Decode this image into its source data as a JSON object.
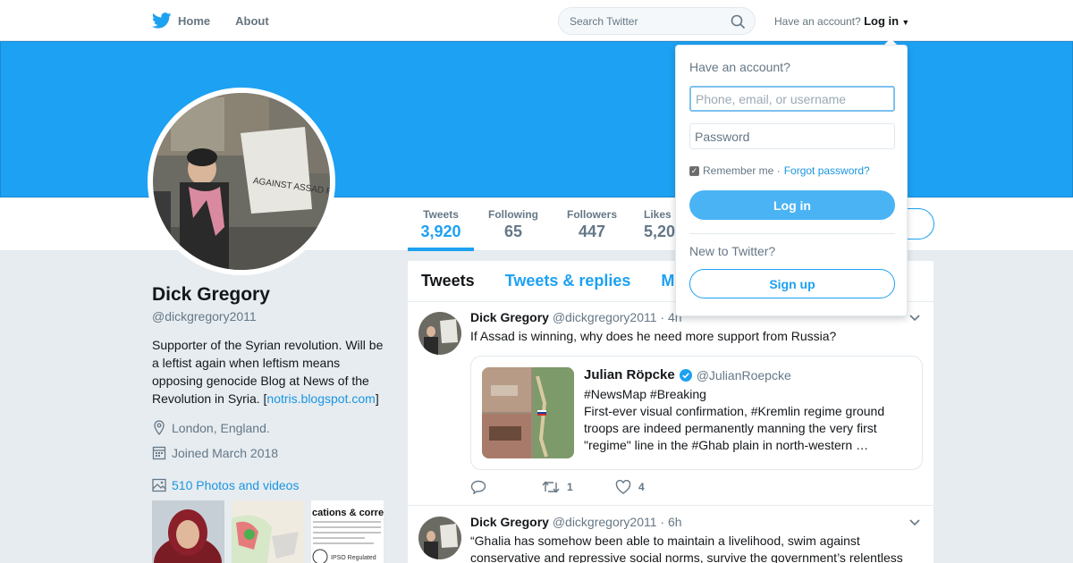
{
  "nav": {
    "home_label": "Home",
    "about_label": "About",
    "search_placeholder": "Search Twitter",
    "have_account_text": "Have an account?",
    "login_label": "Log in"
  },
  "colors": {
    "accent": "#1da1f2",
    "banner": "#1da1f2",
    "link": "#1b95e0"
  },
  "stats": [
    {
      "label": "Tweets",
      "value": "3,920"
    },
    {
      "label": "Following",
      "value": "65"
    },
    {
      "label": "Followers",
      "value": "447"
    },
    {
      "label": "Likes",
      "value": "5,20"
    }
  ],
  "profile": {
    "name": "Dick Gregory",
    "handle": "@dickgregory2011",
    "bio_text": "Supporter of the Syrian revolution. Will be a leftist again when leftism means opposing genocide Blog at News of the Revolution in Syria. [",
    "bio_link": "notris.blogspot.com",
    "bio_end": "]",
    "location": "London, England.",
    "joined": "Joined March 2018",
    "photos_label": "510 Photos and videos",
    "avatar_sign_text": "AGAINST ASSAD RUSSIA IRAN",
    "thumb3_title": "cations & correc",
    "thumb3_badge": "IPSO Regulated"
  },
  "timeline": {
    "tabs": [
      "Tweets",
      "Tweets & replies",
      "M"
    ],
    "tweets": [
      {
        "name": "Dick Gregory",
        "handle": "@dickgregory2011",
        "time": "· 4h",
        "text": "If Assad is winning, why does he need more support from Russia?",
        "quote": {
          "name": "Julian Röpcke",
          "handle": "@JulianRoepcke",
          "text": "#NewsMap #Breaking\nFirst-ever visual confirmation, #Kremlin regime ground troops are indeed permanently manning the very first \"regime\" line in the #Ghab plain in north-western …"
        },
        "replies": "",
        "retweets": "1",
        "likes": "4"
      },
      {
        "name": "Dick Gregory",
        "handle": "@dickgregory2011",
        "time": "· 6h",
        "text": "“Ghalia has somehow been able to maintain a livelihood, swim against conservative and repressive social norms, survive the government’s relentless"
      }
    ]
  },
  "login_dropdown": {
    "title": "Have an account?",
    "username_placeholder": "Phone, email, or username",
    "password_placeholder": "Password",
    "remember_label": "Remember me ·",
    "forgot_label": "Forgot password?",
    "login_button": "Log in",
    "new_label": "New to Twitter?",
    "signup_button": "Sign up"
  }
}
